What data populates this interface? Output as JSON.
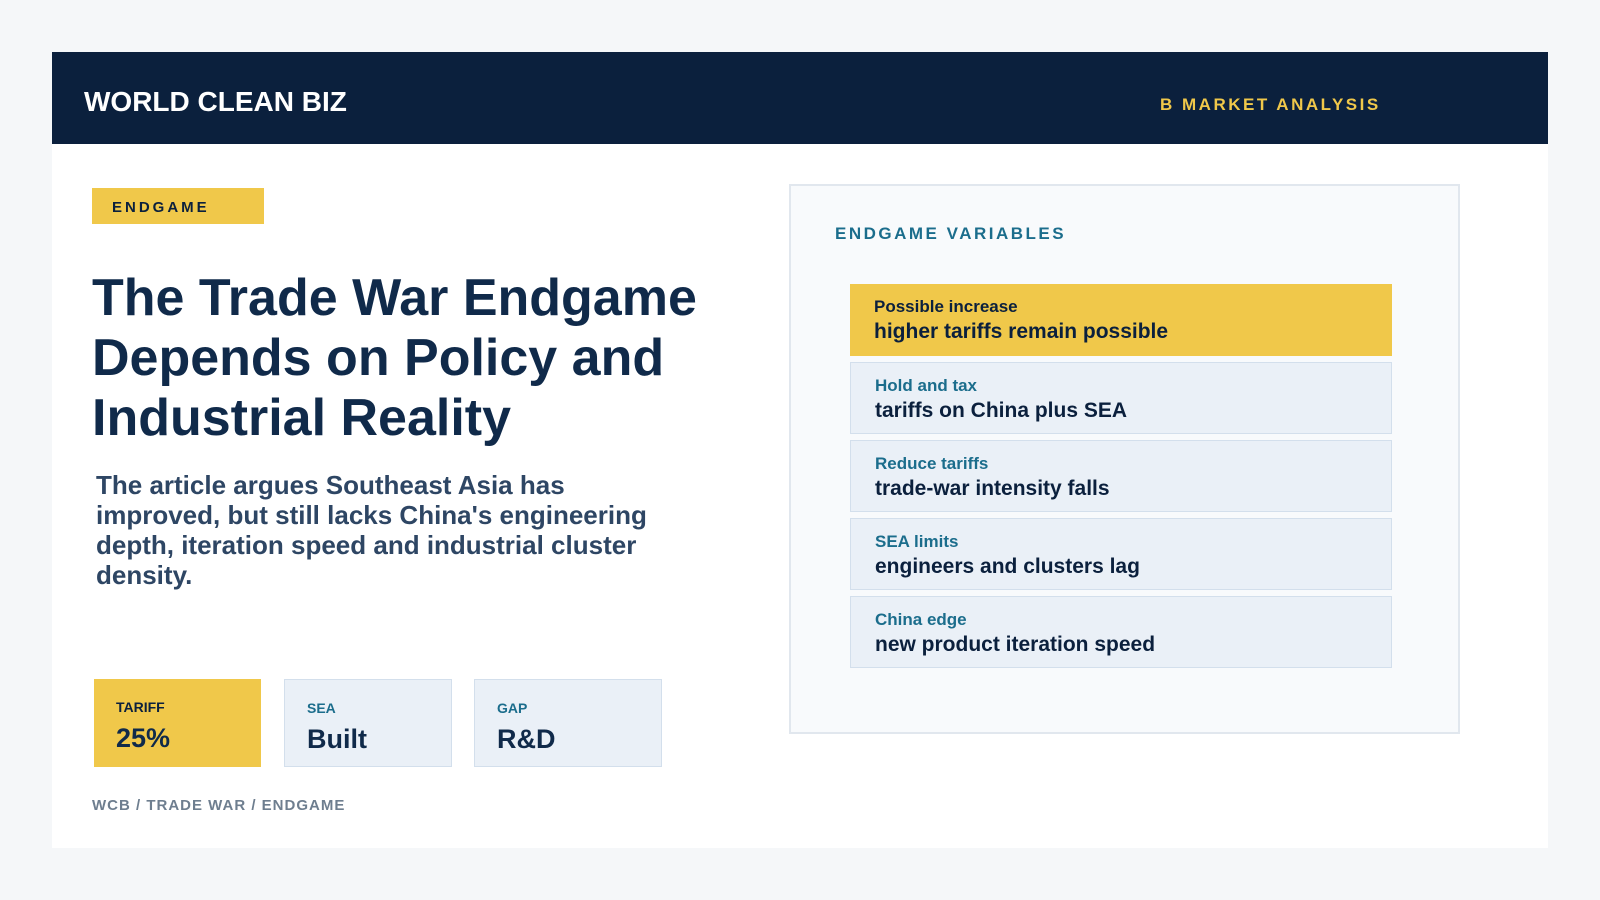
{
  "header": {
    "brand": "WORLD CLEAN BIZ",
    "section": "B MARKET ANALYSIS"
  },
  "article": {
    "tag": "ENDGAME",
    "headline": "The Trade War Endgame Depends on Policy and Industrial Reality",
    "deck": "The article argues Southeast Asia has improved, but still lacks China's engineering depth, iteration speed and industrial cluster density.",
    "stats": [
      {
        "label": "TARIFF",
        "value": "25%"
      },
      {
        "label": "SEA",
        "value": "Built"
      },
      {
        "label": "GAP",
        "value": "R&D"
      }
    ],
    "footer": "WCB / TRADE WAR / ENDGAME"
  },
  "panel": {
    "title": "ENDGAME VARIABLES",
    "variables": [
      {
        "label": "Possible increase",
        "text": "higher tariffs remain possible"
      },
      {
        "label": "Hold and tax",
        "text": "tariffs on China plus SEA"
      },
      {
        "label": "Reduce tariffs",
        "text": "trade-war intensity falls"
      },
      {
        "label": "SEA limits",
        "text": "engineers and clusters lag"
      },
      {
        "label": "China edge",
        "text": "new product iteration speed"
      }
    ]
  },
  "colors": {
    "navy": "#0b203d",
    "accent_yellow": "#f0c84a",
    "teal": "#1b6d8c",
    "card_blue": "#eaf0f7"
  }
}
